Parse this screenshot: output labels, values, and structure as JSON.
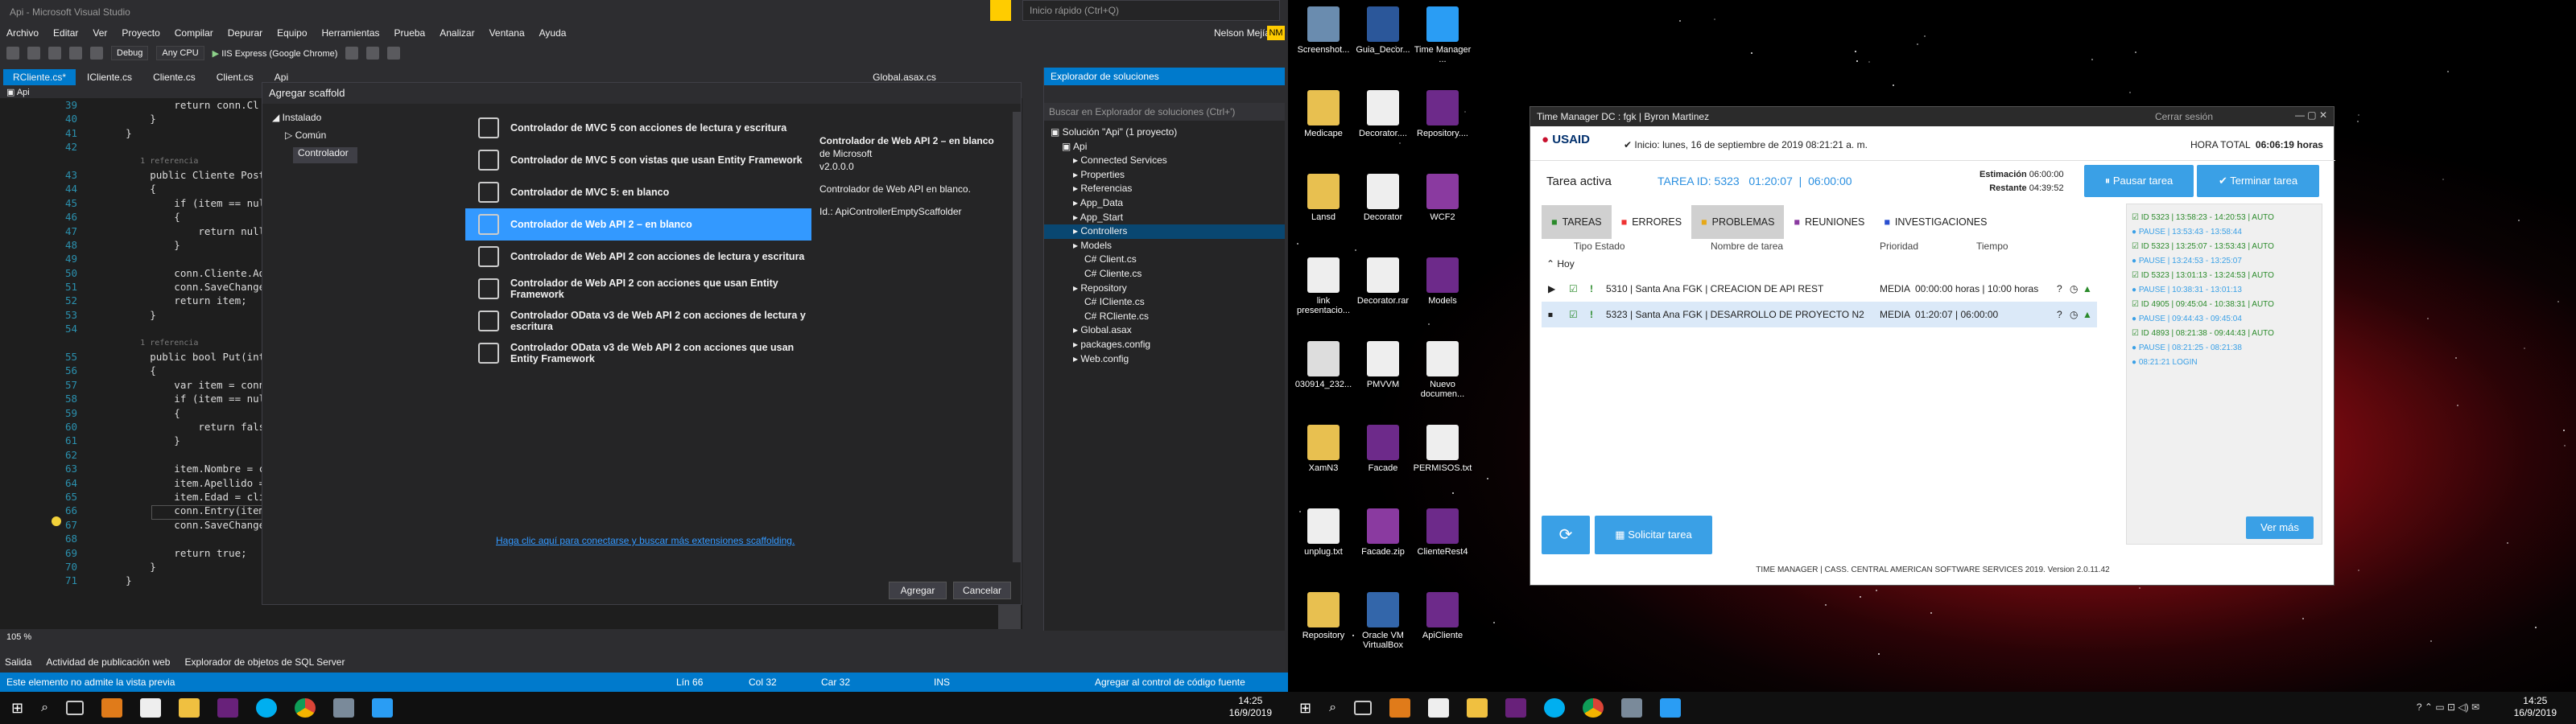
{
  "vs": {
    "title": "Api - Microsoft Visual Studio",
    "menu": [
      "Archivo",
      "Editar",
      "Ver",
      "Proyecto",
      "Compilar",
      "Depurar",
      "Equipo",
      "Herramientas",
      "Prueba",
      "Analizar",
      "Ventana",
      "Ayuda"
    ],
    "quick_launch_placeholder": "Inicio rápido (Ctrl+Q)",
    "user": "Nelson Mejía",
    "user_initials": "NM",
    "toolbar": {
      "config": "Debug",
      "platform": "Any CPU",
      "run": "IIS Express (Google Chrome)"
    },
    "tabs": [
      "RCliente.cs*",
      "ICliente.cs",
      "Cliente.cs",
      "Client.cs",
      "Api",
      "Global.asax.cs"
    ],
    "nav_project": "Api",
    "code_lines": [
      {
        "n": "39",
        "t": "            return conn.Cl"
      },
      {
        "n": "40",
        "t": "        }"
      },
      {
        "n": "41",
        "t": "    }"
      },
      {
        "n": "42",
        "t": ""
      },
      {
        "n": "",
        "t": "        1 referencia"
      },
      {
        "n": "43",
        "t": "        public Cliente Post(Cl"
      },
      {
        "n": "44",
        "t": "        {"
      },
      {
        "n": "45",
        "t": "            if (item == null)"
      },
      {
        "n": "46",
        "t": "            {"
      },
      {
        "n": "47",
        "t": "                return null;"
      },
      {
        "n": "48",
        "t": "            }"
      },
      {
        "n": "49",
        "t": ""
      },
      {
        "n": "50",
        "t": "            conn.Cliente.Add(i"
      },
      {
        "n": "51",
        "t": "            conn.SaveChanges()"
      },
      {
        "n": "52",
        "t": "            return item;"
      },
      {
        "n": "53",
        "t": "        }"
      },
      {
        "n": "54",
        "t": ""
      },
      {
        "n": "",
        "t": "        1 referencia"
      },
      {
        "n": "55",
        "t": "        public bool Put(int id"
      },
      {
        "n": "56",
        "t": "        {"
      },
      {
        "n": "57",
        "t": "            var item = conn.Cl"
      },
      {
        "n": "58",
        "t": "            if (item == null)"
      },
      {
        "n": "59",
        "t": "            {"
      },
      {
        "n": "60",
        "t": "                return false;"
      },
      {
        "n": "61",
        "t": "            }"
      },
      {
        "n": "62",
        "t": ""
      },
      {
        "n": "63",
        "t": "            item.Nombre = clie"
      },
      {
        "n": "64",
        "t": "            item.Apellido = cl"
      },
      {
        "n": "65",
        "t": "            item.Edad = client"
      },
      {
        "n": "66",
        "t": "            conn.Entry(item).S"
      },
      {
        "n": "67",
        "t": "            conn.SaveChanges()"
      },
      {
        "n": "68",
        "t": ""
      },
      {
        "n": "69",
        "t": "            return true;"
      },
      {
        "n": "70",
        "t": "        }"
      },
      {
        "n": "71",
        "t": "    }"
      }
    ],
    "zoom": "105 %",
    "bottom_tabs": [
      "Salida",
      "Actividad de publicación web",
      "Explorador de objetos de SQL Server"
    ],
    "status": {
      "message": "Este elemento no admite la vista previa",
      "line": "Lín 66",
      "col": "Col 32",
      "car": "Car 32",
      "ins": "INS",
      "source": "Agregar al control de código fuente"
    }
  },
  "dialog": {
    "title": "Agregar scaffold",
    "installed": "Instalado",
    "tree": [
      "Común",
      "Controlador"
    ],
    "items": [
      "Controlador de MVC 5 con acciones de lectura y escritura",
      "Controlador de MVC 5 con vistas que usan Entity Framework",
      "Controlador de MVC 5: en blanco",
      "Controlador de Web API 2 – en blanco",
      "Controlador de Web API 2 con acciones de lectura y escritura",
      "Controlador de Web API 2 con acciones que usan Entity Framework",
      "Controlador OData v3 de Web API 2 con acciones de lectura y escritura",
      "Controlador OData v3 de Web API 2 con acciones que usan Entity Framework"
    ],
    "selected_index": 3,
    "detail_title": "Controlador de Web API 2 – en blanco",
    "detail_vendor": "de Microsoft",
    "detail_version": "v2.0.0.0",
    "detail_desc": "Controlador de Web API en blanco.",
    "detail_id": "Id.: ApiControllerEmptyScaffolder",
    "link": "Haga clic aquí para conectarse y buscar más extensiones scaffolding.",
    "add": "Agregar",
    "cancel": "Cancelar"
  },
  "solution": {
    "title": "Explorador de soluciones",
    "search": "Buscar en Explorador de soluciones (Ctrl+')",
    "rows": [
      "Solución \"Api\" (1 proyecto)",
      "Api",
      "Connected Services",
      "Properties",
      "Referencias",
      "App_Data",
      "App_Start",
      "Controllers",
      "Models",
      "Client.cs",
      "Cliente.cs",
      "Repository",
      "ICliente.cs",
      "RCliente.cs",
      "Global.asax",
      "packages.config",
      "Web.config"
    ],
    "indent": [
      0,
      1,
      2,
      2,
      2,
      2,
      2,
      2,
      2,
      3,
      3,
      2,
      3,
      3,
      2,
      2,
      2
    ],
    "selected": 7
  },
  "taskbar_left": {
    "time": "14:25",
    "date": "16/9/2019"
  },
  "taskbar_right": {
    "time": "14:25",
    "date": "16/9/2019"
  },
  "desktop": {
    "icons": [
      "Screenshot...",
      "Guia_Decor...",
      "Time Manager ...",
      "Medicape",
      "Decorator....",
      "Repository....",
      "Lansd",
      "Decorator",
      "WCF2",
      "link presentacio...",
      "Decorator.rar",
      "Models",
      "030914_232...",
      "PMVVM",
      "Nuevo documen...",
      "XamN3",
      "Facade",
      "PERMISOS.txt",
      "unplug.txt",
      "Facade.zip",
      "ClienteRest4",
      "Repository",
      "Oracle VM VirtualBox",
      "ApiCliente"
    ]
  },
  "tm": {
    "title": "Time Manager DC : fgk | Byron Martinez",
    "close_session": "Cerrar sesión",
    "logo": "USAID",
    "start": "Inicio: lunes, 16 de septiembre de 2019 08:21:21 a. m.",
    "total_label": "HORA TOTAL",
    "total": "06:06:19 horas",
    "active_task": "Tarea activa",
    "task_id": "TAREA ID: 5323",
    "task_time": "01:20:07",
    "task_est": "06:00:00",
    "estimacion_label": "Estimación",
    "estimacion": "06:00:00",
    "restante_label": "Restante",
    "restante": "04:39:52",
    "pause": "Pausar tarea",
    "finish": "Terminar tarea",
    "tabs": [
      "TAREAS",
      "ERRORES",
      "PROBLEMAS",
      "REUNIONES",
      "INVESTIGACIONES"
    ],
    "cols": [
      "Tipo Estado",
      "Nombre de tarea",
      "Prioridad",
      "Tiempo"
    ],
    "group": "Hoy",
    "rows": [
      {
        "name": "5310 | Santa Ana FGK | CREACION DE API REST",
        "prio": "MEDIA",
        "time": "00:00:00 horas  |  10:00 horas"
      },
      {
        "name": "5323 | Santa Ana FGK | DESARROLLO DE PROYECTO N2",
        "prio": "MEDIA",
        "time": "01:20:07  |  06:00:00"
      }
    ],
    "log": [
      "ID 5323 | 13:58:23 - 14:20:53 | AUTO",
      "PAUSE | 13:53:43 - 13:58:44",
      "ID 5323 | 13:25:07 - 13:53:43 | AUTO",
      "PAUSE | 13:24:53 - 13:25:07",
      "ID 5323 | 13:01:13 - 13:24:53 | AUTO",
      "PAUSE | 10:38:31 - 13:01:13",
      "ID 4905 | 09:45:04 - 10:38:31 | AUTO",
      "PAUSE | 09:44:43 - 09:45:04",
      "ID 4893 | 08:21:38 - 09:44:43 | AUTO",
      "PAUSE | 08:21:25 - 08:21:38",
      "08:21:21 LOGIN"
    ],
    "ver_mas": "Ver más",
    "request": "Solicitar tarea",
    "footer": "TIME MANAGER | CASS. CENTRAL AMERICAN SOFTWARE SERVICES 2019. Version 2.0.11.42"
  }
}
